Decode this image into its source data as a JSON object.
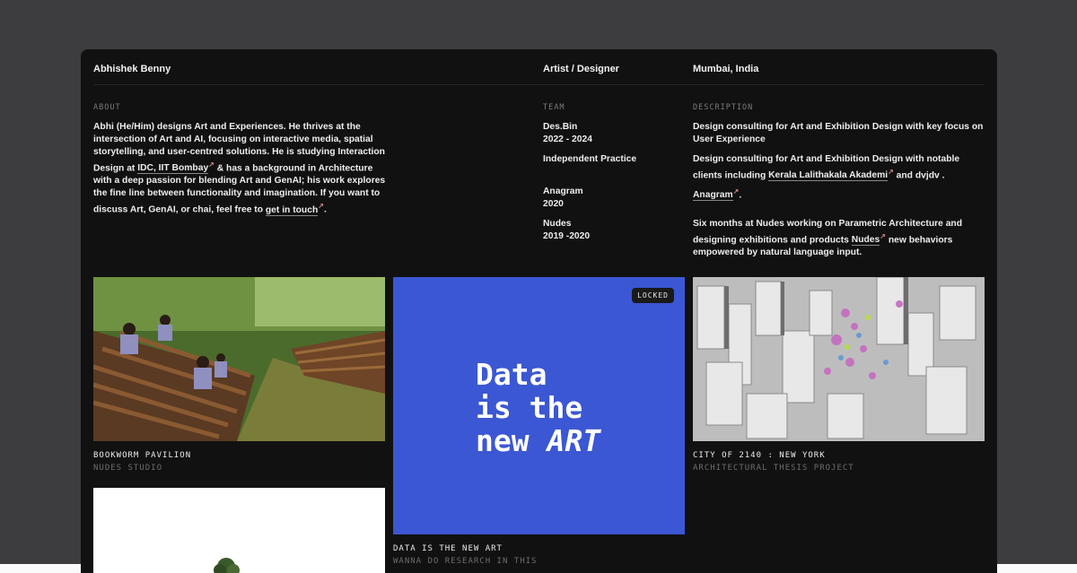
{
  "header": {
    "name": "Abhishek Benny",
    "role": "Artist / Designer",
    "location": "Mumbai, India"
  },
  "about": {
    "label": "ABOUT",
    "text_1": "Abhi (He/Him) designs Art and Experiences. He thrives at the intersection of Art and AI, focusing on interactive media, spatial storytelling, and user-centred solutions. He is studying Interaction Design at ",
    "link_1": "IDC, IIT Bombay",
    "text_2": " & has a background in Architecture with a deep passion for blending Art and GenAI; his work explores the fine line between functionality and imagination. If you want to discuss Art, GenAI, or chai, feel free to ",
    "link_2": "get in touch",
    "text_3": "."
  },
  "team": {
    "label": "TEAM",
    "entries": [
      {
        "name": "Des.Bin",
        "years": "2022 - 2024"
      },
      {
        "name": "Independent Practice",
        "years": ""
      },
      {
        "name": "Anagram",
        "years": "2020"
      },
      {
        "name": "Nudes",
        "years": "2019 -2020"
      }
    ]
  },
  "description": {
    "label": "DESCRIPTION",
    "d1": "Design consulting for Art and Exhibition Design with key focus on User Experience",
    "d2_text": "Design consulting for Art and Exhibition Design with notable clients including ",
    "d2_link": "Kerala Lalithakala Akademi",
    "d2_tail": " and dvjdv .",
    "d3_link": "Anagram",
    "d3_tail": ".",
    "d4_text": "Six months at Nudes working on Parametric Architecture and designing exhibitions and products ",
    "d4_link": "Nudes",
    "d4_tail": " new behaviors empowered by natural language input."
  },
  "projects": [
    {
      "title": "BOOKWORM PAVILION",
      "subtitle": "NUDES STUDIO"
    },
    {
      "title": "DATA IS THE NEW ART",
      "subtitle": "WANNA DO RESEARCH IN THIS",
      "badge": "LOCKED",
      "line1": "Data",
      "line2": "is the",
      "line3a": "new ",
      "line3b": "ART"
    },
    {
      "title": "CITY OF 2140 : NEW YORK",
      "subtitle": "ARCHITECTURAL THESIS PROJECT"
    }
  ],
  "colors": {
    "accent_blue": "#3b57d3",
    "background": "#111111",
    "page": "#3d3d3f"
  }
}
